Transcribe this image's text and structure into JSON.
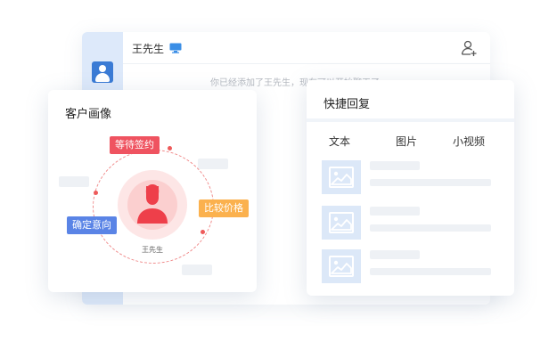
{
  "chat": {
    "contact_name": "王先生",
    "notice": "你已经添加了王先生，现在可以开始聊天了"
  },
  "portrait": {
    "title": "客户画像",
    "customer_name": "王先生",
    "tags": {
      "pending_sign": "等待签约",
      "confirmed_intent": "确定意向",
      "compare_price": "比较价格"
    }
  },
  "quick_reply": {
    "title": "快捷回复",
    "tabs": [
      "文本",
      "图片",
      "小视频"
    ]
  },
  "colors": {
    "accent_blue": "#3a7bd5",
    "tag_red": "#ef5360",
    "tag_blue": "#5a84e6",
    "tag_orange": "#fbb14e"
  }
}
